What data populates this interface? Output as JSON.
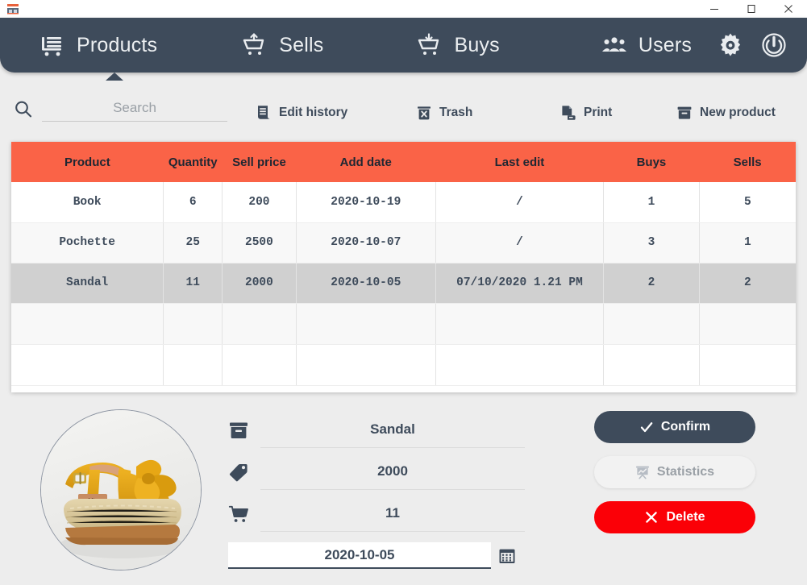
{
  "window": {
    "app_icon": "shop-icon",
    "controls": {
      "minimize": "—",
      "maximize": "☐",
      "close": "✕"
    }
  },
  "navbar": {
    "items": [
      {
        "id": "products",
        "label": "Products",
        "icon": "shopping-cart-list-icon",
        "active": true
      },
      {
        "id": "sells",
        "label": "Sells",
        "icon": "cart-up-arrow-icon",
        "active": false
      },
      {
        "id": "buys",
        "label": "Buys",
        "icon": "cart-down-arrow-icon",
        "active": false
      },
      {
        "id": "users",
        "label": "Users",
        "icon": "users-group-icon",
        "active": false
      }
    ],
    "settings_icon": "gear-icon",
    "power_icon": "power-icon",
    "background_color": "#3e4b5b"
  },
  "toolbar": {
    "search": {
      "placeholder": "Search",
      "value": "",
      "icon": "search-icon"
    },
    "buttons": [
      {
        "id": "edit-history",
        "label": "Edit history",
        "icon": "receipt-icon"
      },
      {
        "id": "trash",
        "label": "Trash",
        "icon": "trash-icon"
      },
      {
        "id": "print",
        "label": "Print",
        "icon": "printer-icon"
      },
      {
        "id": "new-product",
        "label": "New product",
        "icon": "box-icon"
      }
    ]
  },
  "table": {
    "header_color": "#fa6347",
    "columns": [
      "Product",
      "Quantity",
      "Sell price",
      "Add date",
      "Last edit",
      "Buys",
      "Sells"
    ],
    "rows": [
      {
        "product": "Book",
        "quantity": "6",
        "sell_price": "200",
        "add_date": "2020-10-19",
        "last_edit": "/",
        "buys": "1",
        "sells": "5",
        "state": "normal"
      },
      {
        "product": "Pochette",
        "quantity": "25",
        "sell_price": "2500",
        "add_date": "2020-10-07",
        "last_edit": "/",
        "buys": "3",
        "sells": "1",
        "state": "alt"
      },
      {
        "product": "Sandal",
        "quantity": "11",
        "sell_price": "2000",
        "add_date": "2020-10-05",
        "last_edit": "07/10/2020 1.21 PM",
        "buys": "2",
        "sells": "2",
        "state": "selected"
      },
      {
        "product": "",
        "quantity": "",
        "sell_price": "",
        "add_date": "",
        "last_edit": "",
        "buys": "",
        "sells": "",
        "state": "alt"
      },
      {
        "product": "",
        "quantity": "",
        "sell_price": "",
        "add_date": "",
        "last_edit": "",
        "buys": "",
        "sells": "",
        "state": "normal"
      }
    ]
  },
  "detail": {
    "photo": {
      "alt": "sandal-product-photo",
      "colors": {
        "upper": "#e0a91c",
        "sole": "#d9c49a",
        "welt": "#b5793f"
      }
    },
    "fields": [
      {
        "id": "name",
        "icon": "box-icon",
        "value": "Sandal"
      },
      {
        "id": "price",
        "icon": "tag-icon",
        "value": "2000"
      },
      {
        "id": "quantity",
        "icon": "cart-icon",
        "value": "11"
      }
    ],
    "date": {
      "value": "2020-10-05",
      "icon": "calendar-icon"
    },
    "actions": [
      {
        "id": "confirm",
        "label": "Confirm",
        "icon": "check-icon",
        "disabled": false,
        "color": "#3e4b5b"
      },
      {
        "id": "statistics",
        "label": "Statistics",
        "icon": "chart-board-icon",
        "disabled": true,
        "color": "#f2f2f2"
      },
      {
        "id": "delete",
        "label": "Delete",
        "icon": "x-icon",
        "disabled": false,
        "color": "#fb0007"
      }
    ]
  }
}
